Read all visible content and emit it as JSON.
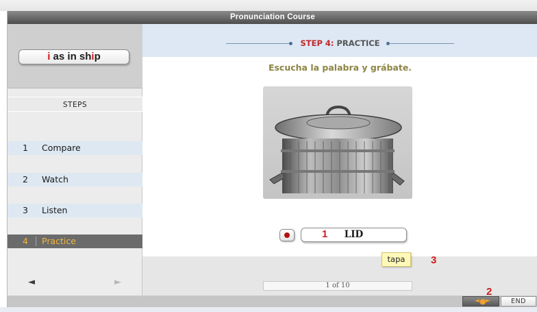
{
  "window": {
    "title": "Pronunciation Course"
  },
  "sidebar": {
    "sound": {
      "before": "i",
      "middle": " as in sh",
      "highlight": "i",
      "after": "p"
    },
    "steps_heading": "STEPS",
    "steps": [
      {
        "num": "1",
        "label": "Compare",
        "active": false
      },
      {
        "num": "2",
        "label": "Watch",
        "active": false
      },
      {
        "num": "3",
        "label": "Listen",
        "active": false
      },
      {
        "num": "4",
        "label": "Practice",
        "active": true
      }
    ],
    "prev_arrow": "◄",
    "next_arrow": "►"
  },
  "content": {
    "step_prefix": "STEP 4:",
    "step_name": " PRACTICE",
    "instruction": "Escucha la palabra y grábate.",
    "image_icon": "trash-can-image",
    "word": "LID",
    "tooltip": "tapa",
    "counter": "1 of 10"
  },
  "annotations": {
    "n1": "1",
    "n2": "2",
    "n3": "3"
  },
  "bottombar": {
    "audio_icon": "speaker-icon",
    "end_label": "END"
  },
  "colors": {
    "accent_red": "#c8201f",
    "active_step_text": "#f4b63c",
    "step_bg": "#dde8f2"
  }
}
